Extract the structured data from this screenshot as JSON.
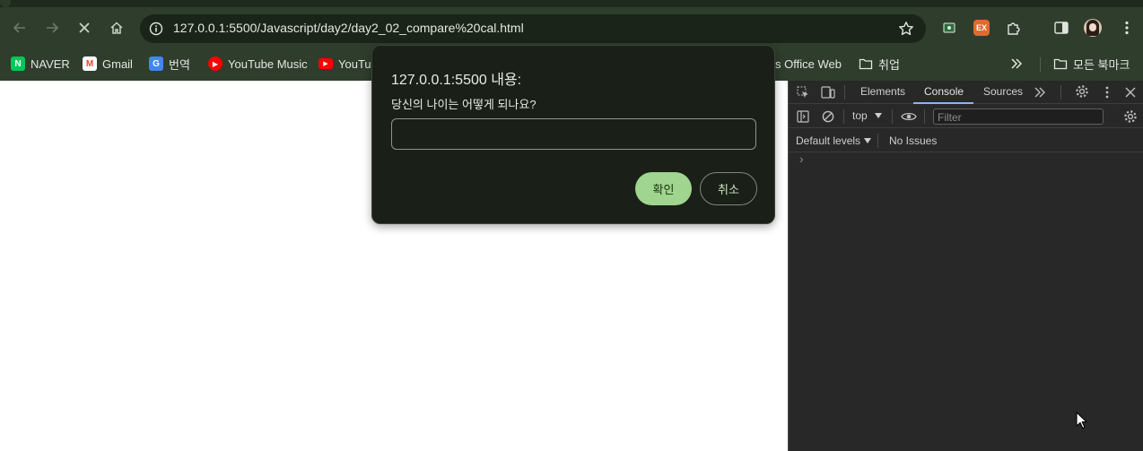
{
  "browser": {
    "url": "127.0.0.1:5500/Javascript/day2/day2_02_compare%20cal.html",
    "ext_badge": "EX"
  },
  "bookmarks": {
    "items": [
      {
        "label": "NAVER",
        "icon": "naver-icon",
        "color": "#03c75a",
        "glyph": "N"
      },
      {
        "label": "Gmail",
        "icon": "gmail-icon",
        "color": "#ea4335",
        "glyph": "M"
      },
      {
        "label": "번역",
        "icon": "translate-icon",
        "color": "#4285f4",
        "glyph": "G"
      },
      {
        "label": "YouTube Music",
        "icon": "youtube-music-icon",
        "color": "#ff0000",
        "glyph": "▶"
      },
      {
        "label": "YouTub",
        "icon": "youtube-icon",
        "color": "#ff0000",
        "glyph": "▶"
      },
      {
        "label": "s Office Web",
        "icon": "office-icon",
        "color": "",
        "glyph": ""
      },
      {
        "label": "취업",
        "icon": "folder-icon",
        "color": "",
        "glyph": ""
      }
    ],
    "all_bookmarks": "모든 북마크"
  },
  "dialog": {
    "title": "127.0.0.1:5500 내용:",
    "message": "당신의 나이는 어떻게 되나요?",
    "input_value": "",
    "ok_label": "확인",
    "cancel_label": "취소"
  },
  "devtools": {
    "tabs": [
      "Elements",
      "Console",
      "Sources"
    ],
    "active_tab": "Console",
    "context": "top",
    "filter_placeholder": "Filter",
    "levels": "Default levels",
    "issues": "No Issues",
    "prompt": "›"
  },
  "colors": {
    "toolbar": "#2f3d2d",
    "dialog_bg": "#1a1f18",
    "ok_button": "#9fd58e",
    "devtools_bg": "#282828",
    "devtools_accent": "#8ab4f8"
  }
}
